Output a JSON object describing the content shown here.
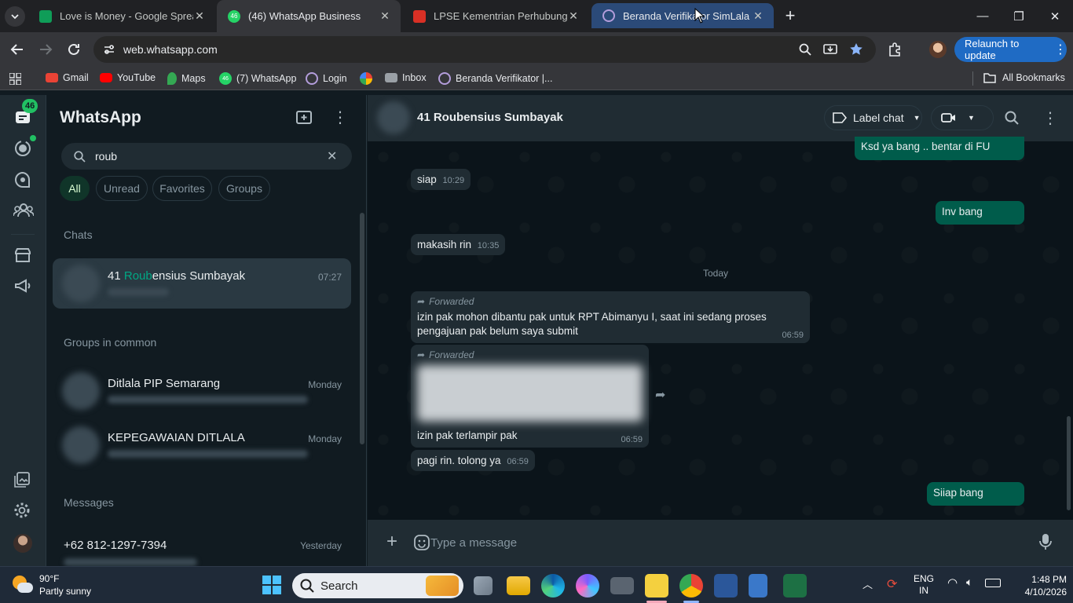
{
  "tabs": [
    {
      "title": "Love is Money - Google Spread",
      "color": "#0f9d58"
    },
    {
      "title": "(46) WhatsApp Business",
      "badge": "46",
      "color": "#25d366"
    },
    {
      "title": "LPSE Kementrian Perhubungan",
      "color": "#d93025"
    },
    {
      "title": "Beranda Verifikator SimLala",
      "color": "#8e44ad"
    }
  ],
  "toolbar": {
    "url": "web.whatsapp.com",
    "relaunch_label": "Relaunch to update"
  },
  "bookmarks": {
    "items": [
      {
        "label": "Gmail",
        "color": "#ea4335"
      },
      {
        "label": "YouTube",
        "color": "#ff0000"
      },
      {
        "label": "Maps",
        "color": "#34a853"
      },
      {
        "label": "(7) WhatsApp",
        "badge": "46",
        "color": "#25d366"
      },
      {
        "label": "Login",
        "color": "#8e44ad"
      },
      {
        "label": "",
        "color": "#fbbc04"
      },
      {
        "label": "Inbox",
        "color": "#9aa0a6"
      },
      {
        "label": "Beranda Verifikator |...",
        "color": "#8e44ad"
      }
    ],
    "all_label": "All Bookmarks"
  },
  "rail": {
    "chat_badge": "46"
  },
  "sidebar": {
    "title": "WhatsApp",
    "search_value": "roub",
    "filters": [
      "All",
      "Unread",
      "Favorites",
      "Groups"
    ],
    "chats_header": "Chats",
    "chat_result": {
      "prefix": "41 ",
      "highlight": "Roub",
      "rest": "ensius Sumbayak",
      "time": "07:27"
    },
    "groups_header": "Groups in common",
    "groups": [
      {
        "name": "Ditlala PIP Semarang",
        "time": "Monday"
      },
      {
        "name": "KEPEGAWAIAN DITLALA",
        "time": "Monday"
      }
    ],
    "messages_header": "Messages",
    "message_result": {
      "name": "+62 812-1297-7394",
      "time": "Yesterday"
    }
  },
  "chat": {
    "contact_name": "41 Roubensius Sumbayak",
    "label_chat": "Label chat",
    "messages": {
      "m1": {
        "text": "Ksd ya bang .. bentar di FU"
      },
      "m2": {
        "text": "siap",
        "time": "10:29"
      },
      "m3": {
        "text": "Inv bang"
      },
      "m4": {
        "text": "makasih rin",
        "time": "10:35"
      },
      "date_divider": "Today",
      "m5": {
        "forwarded": "Forwarded",
        "text": "izin pak mohon dibantu pak untuk RPT Abimanyu I, saat ini sedang proses pengajuan pak belum saya submit",
        "time": "06:59"
      },
      "m6": {
        "forwarded": "Forwarded",
        "text": "izin pak terlampir pak",
        "time": "06:59"
      },
      "m7": {
        "text": "pagi rin. tolong ya",
        "time": "06:59"
      },
      "m8": {
        "text": "Siiap bang"
      }
    },
    "composer_placeholder": "Type a message"
  },
  "taskbar": {
    "weather_temp": "90°F",
    "weather_desc": "Partly sunny",
    "search_label": "Search",
    "lang_top": "ENG",
    "lang_bottom": "IN",
    "time": "1:48 PM",
    "date": "4/10/2026"
  }
}
